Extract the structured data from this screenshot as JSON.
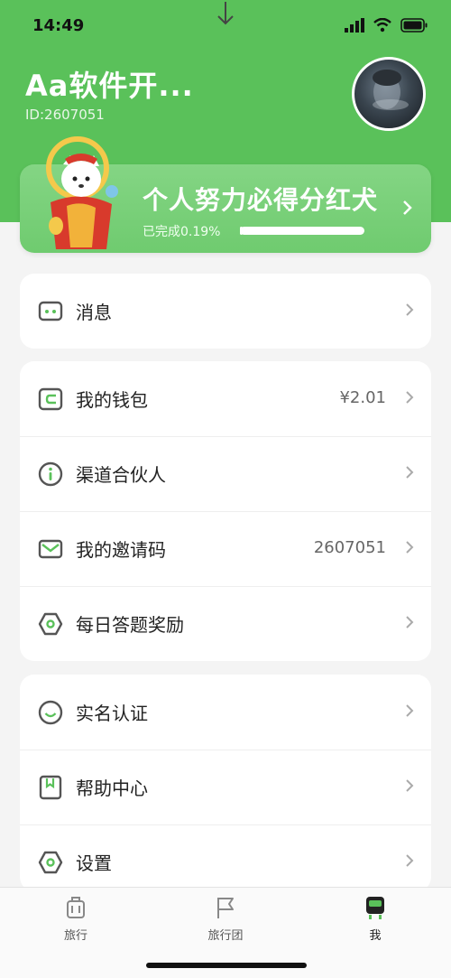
{
  "status_bar": {
    "time": "14:49"
  },
  "profile": {
    "name": "Aa软件开...",
    "id_text": "ID:2607051"
  },
  "banner": {
    "title": "个人努力必得分红犬",
    "progress_label": "已完成0.19%",
    "progress": 0.0019
  },
  "cards": [
    {
      "rows": [
        {
          "icon": "message-icon",
          "label": "消息",
          "value": ""
        }
      ]
    },
    {
      "rows": [
        {
          "icon": "wallet-icon",
          "label": "我的钱包",
          "value": "¥2.01"
        },
        {
          "icon": "info-icon",
          "label": "渠道合伙人",
          "value": ""
        },
        {
          "icon": "mail-icon",
          "label": "我的邀请码",
          "value": "2607051"
        },
        {
          "icon": "hexagon-icon",
          "label": "每日答题奖励",
          "value": ""
        }
      ]
    },
    {
      "rows": [
        {
          "icon": "smile-icon",
          "label": "实名认证",
          "value": ""
        },
        {
          "icon": "bookmark-icon",
          "label": "帮助中心",
          "value": ""
        },
        {
          "icon": "settings-icon",
          "label": "设置",
          "value": ""
        }
      ]
    }
  ],
  "tabbar": {
    "tabs": [
      {
        "icon": "luggage-icon",
        "label": "旅行"
      },
      {
        "icon": "flag-icon",
        "label": "旅行团"
      },
      {
        "icon": "robot-icon",
        "label": "我"
      }
    ]
  },
  "colors": {
    "brand_green": "#5ac15a",
    "icon_green": "#5ac15a",
    "icon_gray": "#555555"
  }
}
